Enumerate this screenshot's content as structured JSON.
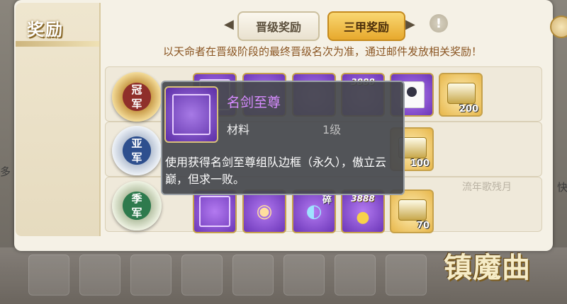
{
  "sidebar": {
    "title": "奖励"
  },
  "tabs": {
    "promotion": "晋级奖励",
    "third": "三甲奖励"
  },
  "notice": "以天命者在晋级阶段的最终晋级名次为准，通过邮件发放相关奖励！",
  "ranks": {
    "first": "冠\n军",
    "second": "亚\n军",
    "third": "季\n军"
  },
  "quantities": {
    "chest_first": "200",
    "chest_second": "100",
    "chest_third": "70"
  },
  "coin_amount": "3888",
  "fragment_label": "碎",
  "tooltip": {
    "name": "名剑至尊",
    "type": "材料",
    "level": "1级",
    "description": "使用获得名剑至尊组队边框（永久），傲立云巅，但求一败。"
  },
  "background_name": "流年歌残月",
  "logo": "镇魔曲",
  "edge_left": "多",
  "edge_right": "快",
  "icons": {
    "info": "info-icon",
    "close": "close-icon",
    "arrow_left": "arrow-left-icon",
    "arrow_right": "arrow-right-icon"
  },
  "colors": {
    "accent_gold": "#e7a92d",
    "tooltip_name": "#d78cff",
    "notice": "#8a5522"
  }
}
